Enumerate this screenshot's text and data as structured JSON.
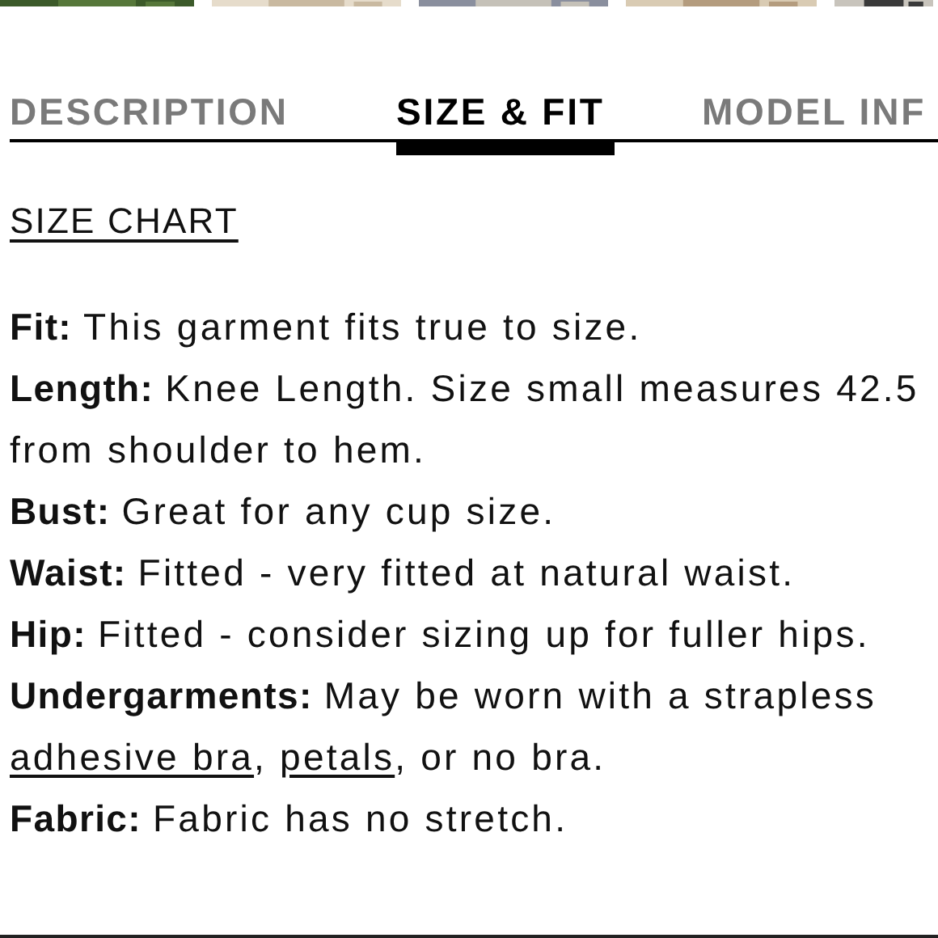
{
  "tabs": [
    {
      "label": "DESCRIPTION",
      "selected": false
    },
    {
      "label": "SIZE & FIT",
      "selected": true
    },
    {
      "label": "MODEL INF",
      "selected": false
    }
  ],
  "size_chart_link": "SIZE CHART",
  "details": [
    {
      "label": "Fit:",
      "lines": [
        [
          {
            "kind": "text",
            "text": "This garment fits true to size."
          }
        ]
      ]
    },
    {
      "label": "Length:",
      "lines": [
        [
          {
            "kind": "text",
            "text": "Knee Length. Size small measures 42.5"
          }
        ],
        [
          {
            "kind": "text",
            "text": "from shoulder to hem."
          }
        ]
      ]
    },
    {
      "label": "Bust:",
      "lines": [
        [
          {
            "kind": "text",
            "text": "Great for any cup size."
          }
        ]
      ]
    },
    {
      "label": "Waist:",
      "lines": [
        [
          {
            "kind": "text",
            "text": "Fitted - very fitted at natural waist."
          }
        ]
      ]
    },
    {
      "label": "Hip:",
      "lines": [
        [
          {
            "kind": "text",
            "text": "Fitted - consider sizing up for fuller hips."
          }
        ]
      ]
    },
    {
      "label": "Undergarments:",
      "lines": [
        [
          {
            "kind": "text",
            "text": "May be worn with a strapless"
          }
        ],
        [
          {
            "kind": "link",
            "text": "adhesive bra"
          },
          {
            "kind": "text",
            "text": ", "
          },
          {
            "kind": "link",
            "text": "petals"
          },
          {
            "kind": "text",
            "text": ", or no bra."
          }
        ]
      ]
    },
    {
      "label": "Fabric:",
      "lines": [
        [
          {
            "kind": "text",
            "text": "Fabric has no stretch."
          }
        ]
      ]
    }
  ]
}
